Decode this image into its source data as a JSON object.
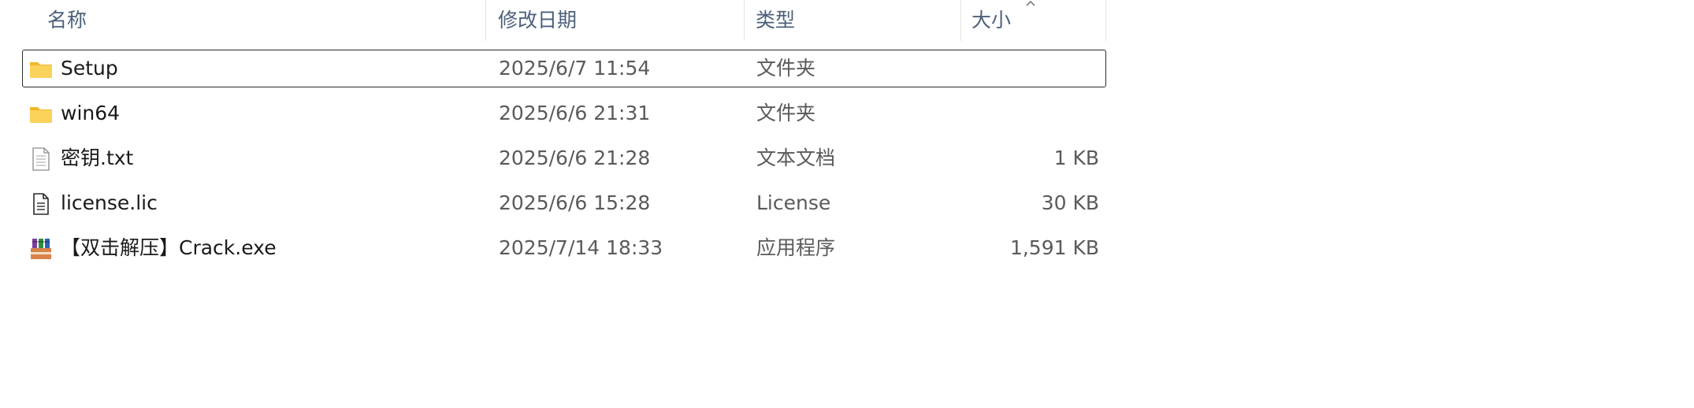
{
  "columns": {
    "name": "名称",
    "date": "修改日期",
    "type": "类型",
    "size": "大小",
    "sort_indicator": "chevron-up-icon"
  },
  "files": [
    {
      "name": "Setup",
      "date": "2025/6/7 11:54",
      "type": "文件夹",
      "size": "",
      "icon": "folder-icon",
      "focused": true
    },
    {
      "name": "win64",
      "date": "2025/6/6 21:31",
      "type": "文件夹",
      "size": "",
      "icon": "folder-icon",
      "focused": false
    },
    {
      "name": "密钥.txt",
      "date": "2025/6/6 21:28",
      "type": "文本文档",
      "size": "1 KB",
      "icon": "text-file-icon",
      "focused": false
    },
    {
      "name": "license.lic",
      "date": "2025/6/6 15:28",
      "type": "License",
      "size": "30 KB",
      "icon": "document-file-icon",
      "focused": false
    },
    {
      "name": "【双击解压】Crack.exe",
      "date": "2025/7/14 18:33",
      "type": "应用程序",
      "size": "1,591 KB",
      "icon": "archive-exe-icon",
      "focused": false
    }
  ],
  "colors": {
    "header_text": "#4c607a",
    "folder": "#f8c83a",
    "focus_border": "#2b2b2b"
  }
}
